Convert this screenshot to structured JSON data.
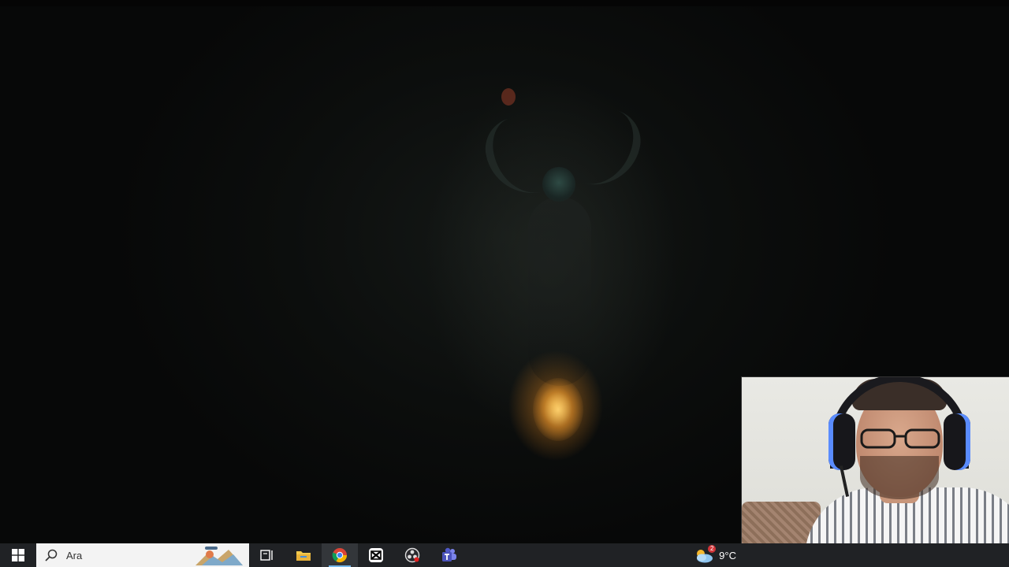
{
  "taskbar": {
    "start_icon": "windows-logo-icon",
    "search": {
      "text": "Ara",
      "icon": "search-icon",
      "art_icon": "search-highlight-art-icon"
    },
    "pinned": [
      {
        "name": "task-view-icon"
      },
      {
        "name": "file-explorer-icon"
      },
      {
        "name": "chrome-icon",
        "active": true
      },
      {
        "name": "capcut-icon"
      },
      {
        "name": "obs-recorder-icon"
      },
      {
        "name": "teams-icon"
      }
    ],
    "tray": {
      "weather_icon": "weather-cloud-sun-icon",
      "weather_badge": "2",
      "temperature": "9°C"
    }
  },
  "colors": {
    "taskbar_bg": "#202225",
    "active_indicator": "#76b9ed",
    "fire_glow": "#ffbe46"
  }
}
